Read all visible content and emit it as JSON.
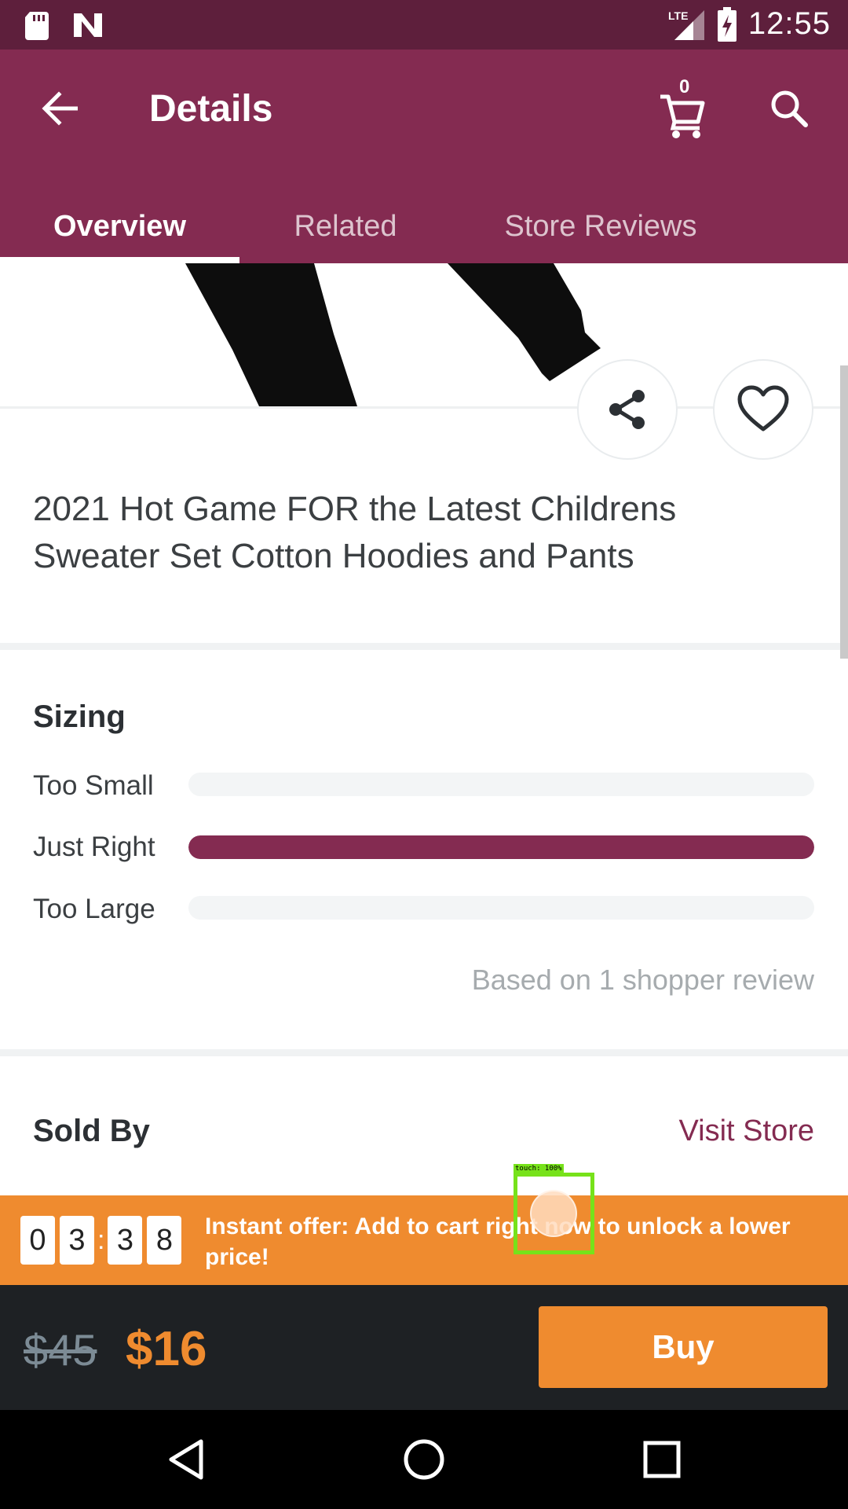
{
  "status_bar": {
    "time": "12:55",
    "network": "LTE",
    "icons": [
      "sd-card-icon",
      "n-notification-icon",
      "lte-signal-icon",
      "battery-charging-icon"
    ]
  },
  "app_bar": {
    "title": "Details",
    "cart_count": "0",
    "icons": [
      "back-arrow-icon",
      "cart-icon",
      "search-icon"
    ]
  },
  "tabs": [
    {
      "label": "Overview",
      "active": true
    },
    {
      "label": "Related",
      "active": false
    },
    {
      "label": "Store Reviews",
      "active": false
    }
  ],
  "product": {
    "title": "2021 Hot Game FOR the Latest Childrens Sweater Set Cotton Hoodies and Pants",
    "image_icon": "pants-image"
  },
  "actions": {
    "share_icon": "share-icon",
    "favorite_icon": "heart-icon"
  },
  "sizing": {
    "title": "Sizing",
    "rows": [
      {
        "label": "Too Small",
        "fraction": 0
      },
      {
        "label": "Just Right",
        "fraction": 1
      },
      {
        "label": "Too Large",
        "fraction": 0
      }
    ],
    "based_on": "Based on 1 shopper review"
  },
  "sold_by": {
    "title": "Sold By",
    "visit_store": "Visit Store"
  },
  "offer": {
    "timer_digits": [
      "0",
      "3",
      "3",
      "8"
    ],
    "timer_separator": ":",
    "text": "Instant offer: Add to cart right now to unlock a lower price!"
  },
  "buy_bar": {
    "old_price": "$45",
    "new_price": "$16",
    "buy_label": "Buy"
  },
  "nav_bar": {
    "icons": [
      "back-triangle-icon",
      "home-circle-icon",
      "recents-square-icon"
    ]
  },
  "touch_overlay": {
    "label": "touch: 100%"
  },
  "colors": {
    "status_bar": "#5e1f3c",
    "app_bar": "#842b51",
    "accent": "#ef8b2f",
    "buy_bar": "#1e2124"
  }
}
